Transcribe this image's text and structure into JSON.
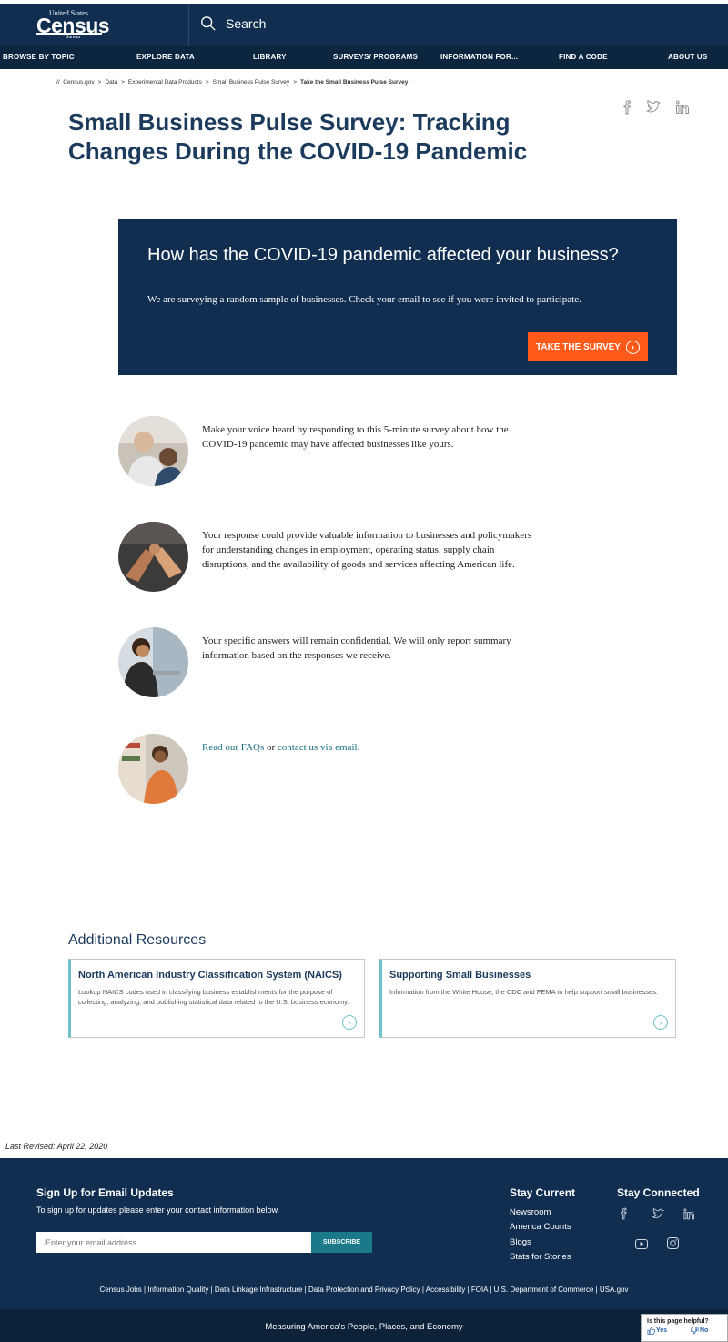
{
  "header": {
    "logo_top": "United States",
    "logo_main": "Census",
    "logo_sub": "Bureau",
    "search_label": "Search"
  },
  "nav": [
    "BROWSE BY TOPIC",
    "EXPLORE DATA",
    "LIBRARY",
    "SURVEYS/ PROGRAMS",
    "INFORMATION FOR...",
    "FIND A CODE",
    "ABOUT US"
  ],
  "breadcrumb": {
    "prefix": "//",
    "items": [
      "Census.gov",
      "Data",
      "Experimental Data Products",
      "Small Business Pulse Survey"
    ],
    "current": "Take the Small Business Pulse Survey",
    "separator": ">"
  },
  "page_title": "Small Business Pulse Survey: Tracking Changes During the COVID-19 Pandemic",
  "hero": {
    "heading": "How has the COVID-19 pandemic affected your business?",
    "body": "We are surveying a random sample of businesses. Check your email to see if you were invited to participate.",
    "cta_label": "TAKE THE SURVEY",
    "cta_arrow": "›"
  },
  "info": {
    "row1": "Make your voice heard by responding to this 5-minute survey about how the COVID-19 pandemic may have affected businesses like yours.",
    "row2": "Your response could provide valuable information to businesses and policymakers for understanding changes in employment, operating status, supply chain disruptions, and the availability of goods and services affecting American life.",
    "row3": "Your specific answers will remain confidential. We will only report summary information based on the responses we receive.",
    "row4_link1": "Read our FAQs",
    "row4_mid": " or ",
    "row4_link2": "contact us via email."
  },
  "resources": {
    "title": "Additional Resources",
    "cards": [
      {
        "title": "North American Industry Classification System (NAICS)",
        "body": "Lookup NAICS codes used in classifying business establishments for the purpose of collecting, analyzing, and publishing statistical data related to the U.S. business economy."
      },
      {
        "title": "Supporting Small Businesses",
        "body": "Information from the White House, the CDC and FEMA to help support small businesses."
      }
    ],
    "arrow": "›"
  },
  "last_revised": "Last Revised: April 22, 2020",
  "footer": {
    "signup_title": "Sign Up for Email Updates",
    "signup_sub": "To sign up for updates please enter your contact information below.",
    "email_placeholder": "Enter your email address",
    "subscribe_label": "SUBSCRIBE",
    "stay_current_title": "Stay Current",
    "stay_current_links": [
      "Newsroom",
      "America Counts",
      "Blogs",
      "Stats for Stories"
    ],
    "stay_connected_title": "Stay Connected",
    "links": "Census Jobs | Information Quality | Data Linkage Infrastructure | Data Protection and Privacy Policy | Accessibility | FOIA | U.S. Department of Commerce | USA.gov",
    "tagline": "Measuring America's People, Places, and Economy"
  },
  "helpful": {
    "question": "Is this page helpful?",
    "yes": "Yes",
    "no": "No"
  },
  "colors": {
    "navy": "#112e51",
    "orange": "#ff5a19",
    "teal": "#6ec1c9",
    "link": "#1a6e80"
  }
}
